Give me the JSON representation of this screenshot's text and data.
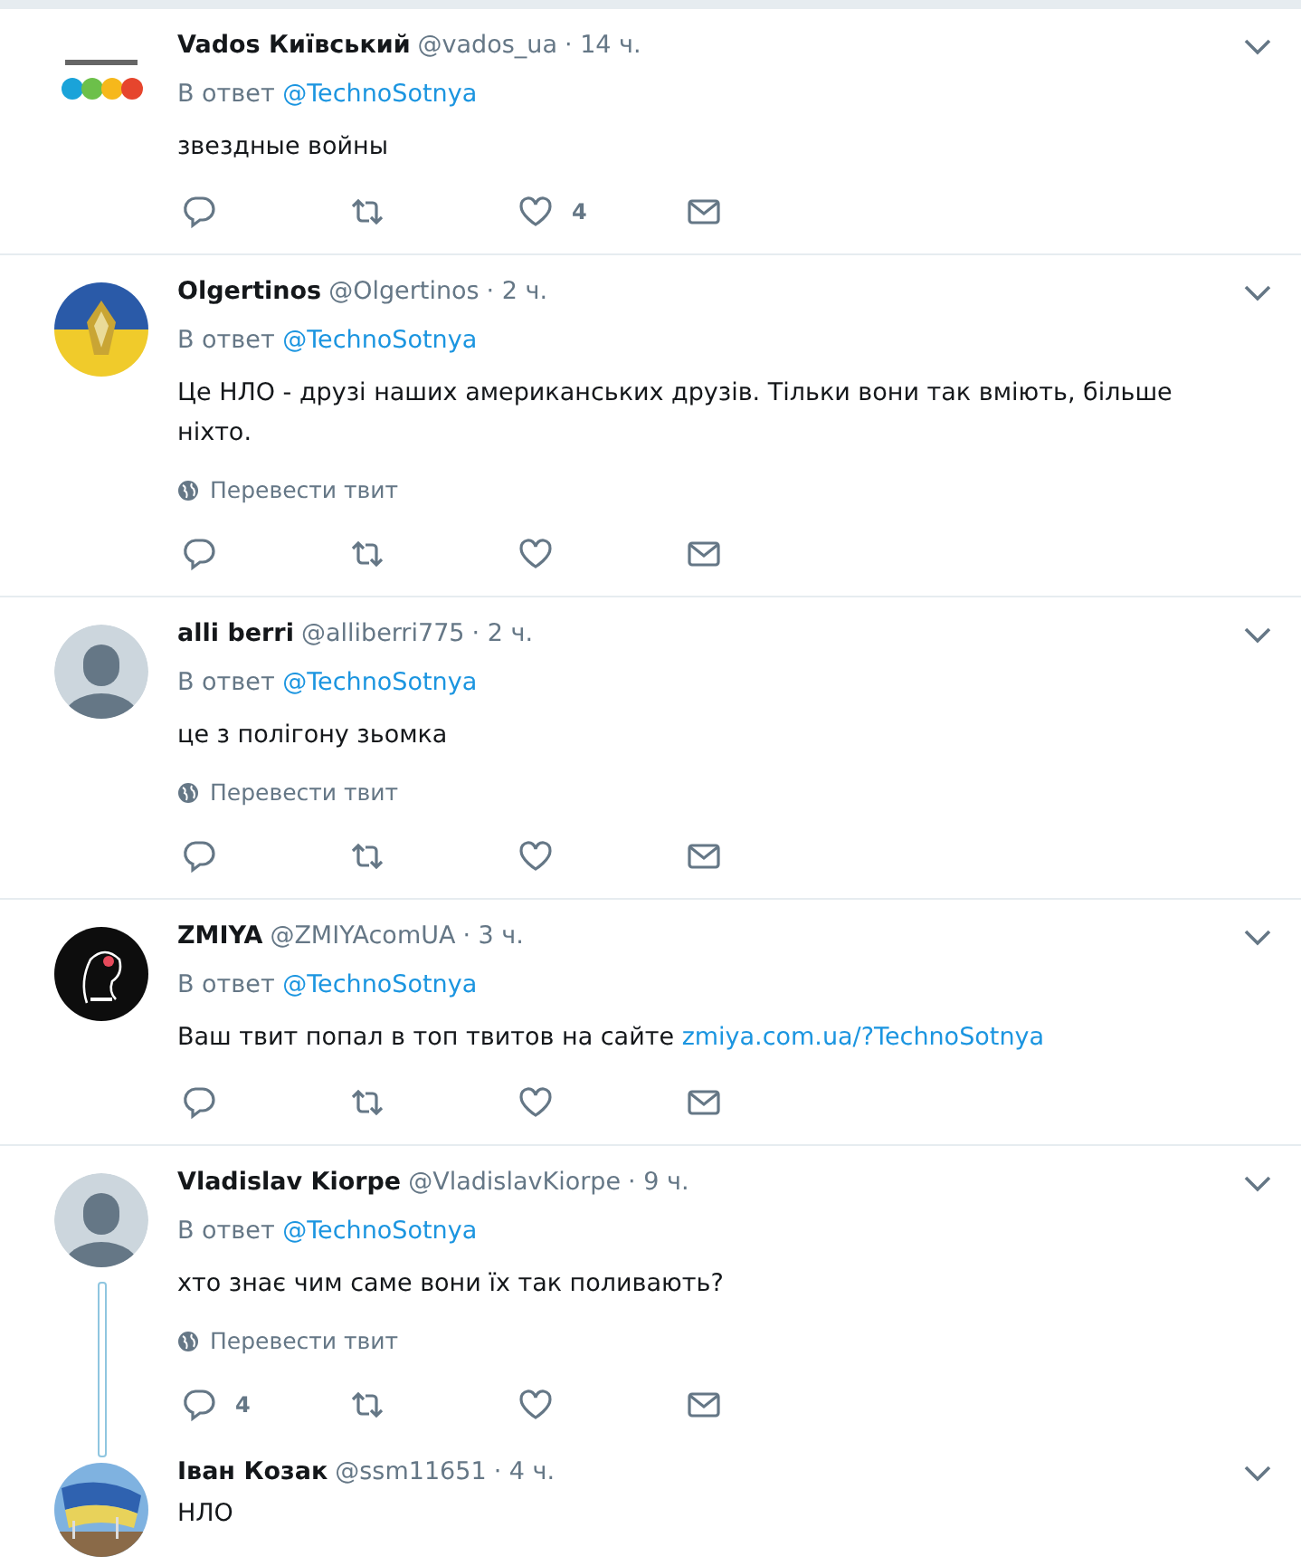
{
  "tweets": [
    {
      "name": "Vados Київський",
      "handle": "@vados_ua",
      "time": "· 14 ч.",
      "reply_label": "В ответ",
      "reply_to": "@TechnoSotnya",
      "text": "звездные войны",
      "actions": [
        {
          "kind": "reply"
        },
        {
          "kind": "retweet"
        },
        {
          "kind": "like",
          "count": "4"
        },
        {
          "kind": "dm"
        }
      ]
    },
    {
      "name": "Olgertinos",
      "handle": "@Olgertinos",
      "time": "· 2 ч.",
      "reply_label": "В ответ",
      "reply_to": "@TechnoSotnya",
      "text": "Це НЛО - друзі наших американських друзів. Тільки вони так вміють, більше ніхто.",
      "translate": "Перевести твит",
      "actions": [
        {
          "kind": "reply"
        },
        {
          "kind": "retweet"
        },
        {
          "kind": "like"
        },
        {
          "kind": "dm"
        }
      ]
    },
    {
      "avatar": {
        "kind": "default"
      },
      "name": "alli berri",
      "handle": "@alliberri775",
      "time": "· 2 ч.",
      "reply_label": "В ответ",
      "reply_to": "@TechnoSotnya",
      "text": "це з полігону зьомка",
      "translate": "Перевести твит",
      "actions": [
        {
          "kind": "reply"
        },
        {
          "kind": "retweet"
        },
        {
          "kind": "like"
        },
        {
          "kind": "dm"
        }
      ]
    },
    {
      "name": "ZMIYA",
      "handle": "@ZMIYAcomUA",
      "time": "· 3 ч.",
      "reply_label": "В ответ",
      "reply_to": "@TechnoSotnya",
      "text": "Ваш твит попал в топ твитов на сайте ",
      "link": "zmiya.com.ua/?TechnoSotnya",
      "actions": [
        {
          "kind": "reply"
        },
        {
          "kind": "retweet"
        },
        {
          "kind": "like"
        },
        {
          "kind": "dm"
        }
      ]
    },
    {
      "avatar": {
        "kind": "default"
      },
      "name": "Vladislav Kiorpe",
      "handle": "@VladislavKiorpe",
      "time": "· 9 ч.",
      "reply_label": "В ответ",
      "reply_to": "@TechnoSotnya",
      "text": "хто знає чим саме вони їх так поливають?",
      "translate": "Перевести твит",
      "thread_continues": true,
      "actions": [
        {
          "kind": "reply",
          "count": "4"
        },
        {
          "kind": "retweet"
        },
        {
          "kind": "like"
        },
        {
          "kind": "dm"
        }
      ]
    },
    {
      "name": "Іван Козак",
      "handle": "@ssm11651",
      "time": "· 4 ч.",
      "text": "НЛО"
    }
  ]
}
